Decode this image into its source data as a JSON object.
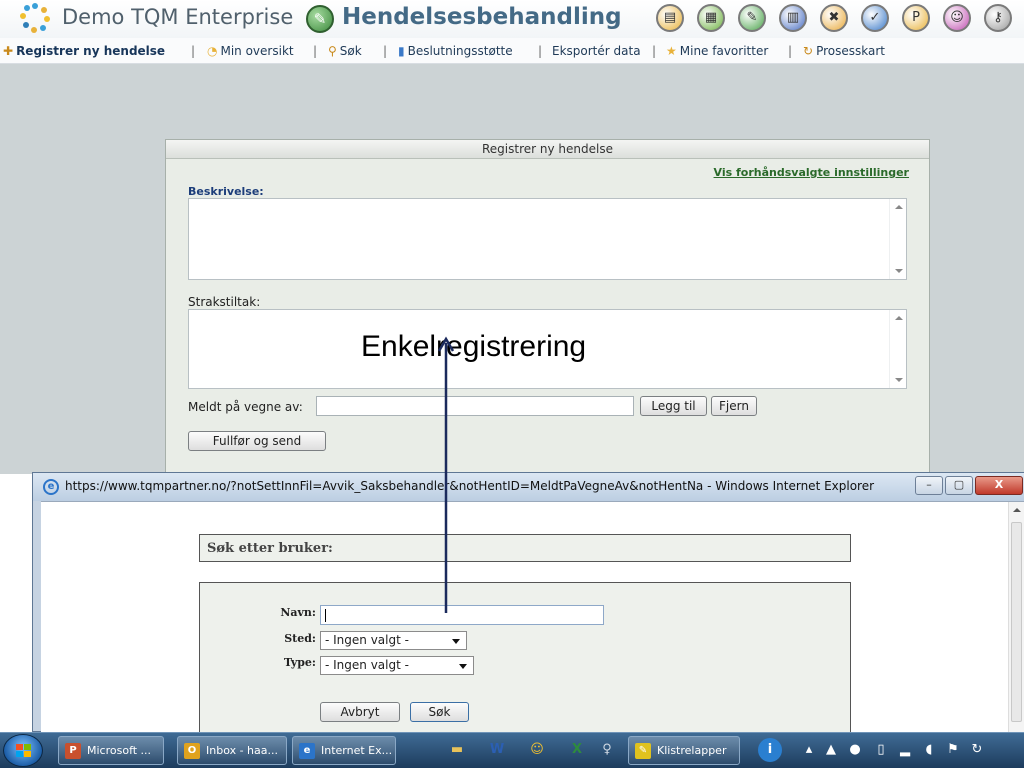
{
  "header": {
    "app_title": "Demo TQM Enterprise",
    "module_title": "Hendelsesbehandling",
    "module_icon": "wrench-icon",
    "toolbar_icons": [
      {
        "icon": "document-icon",
        "color": "#e8b23a"
      },
      {
        "icon": "dashboard-icon",
        "color": "#6cb03f"
      },
      {
        "icon": "wrench-icon",
        "color": "#4aa34a"
      },
      {
        "icon": "calendar-icon",
        "color": "#4a6fc2"
      },
      {
        "icon": "tools-icon",
        "color": "#e8a93a"
      },
      {
        "icon": "checkmark-icon",
        "color": "#3a79c8"
      },
      {
        "icon": "ps-icon",
        "color": "#e8b23a"
      },
      {
        "icon": "people-icon",
        "color": "#c04fb0"
      },
      {
        "icon": "key-icon",
        "color": "#9a9a9a"
      }
    ]
  },
  "nav": {
    "items": [
      {
        "label": "Registrer ny hendelse",
        "icon": "register-icon"
      },
      {
        "label": "Min oversikt",
        "icon": "overview-icon"
      },
      {
        "label": "Søk",
        "icon": "search-icon"
      },
      {
        "label": "Beslutningsstøtte",
        "icon": "chart-icon"
      },
      {
        "label": "Eksportér data",
        "icon": ""
      },
      {
        "label": "Mine favoritter",
        "icon": "star-icon"
      },
      {
        "label": "Prosesskart",
        "icon": "process-icon"
      }
    ],
    "separator": "|"
  },
  "form": {
    "title": "Registrer ny hendelse",
    "presets_link": "Vis forhåndsvalgte innstillinger",
    "description_label": "Beskrivelse:",
    "description_value": "",
    "immediate_action_label": "Strakstiltak:",
    "immediate_action_value": "",
    "reported_on_behalf_label": "Meldt på vegne av:",
    "reported_on_behalf_value": "",
    "add_button": "Legg til",
    "remove_button": "Fjern",
    "submit_button": "Fullfør og send"
  },
  "annotation": {
    "callout_text": "Enkelregistrering",
    "arrow_color": "#1b2a5c"
  },
  "popup": {
    "window_title": "https://www.tqmpartner.no/?notSettInnFil=Avvik_Saksbehandler&notHentID=MeldtPaVegneAv&notHentNa - Windows Internet Explorer",
    "minimize_label": "–",
    "maximize_label": "▢",
    "close_label": "X",
    "search_heading": "Søk etter bruker:",
    "name_label": "Navn:",
    "name_value": "",
    "place_label": "Sted:",
    "place_selected": "- Ingen valgt -",
    "type_label": "Type:",
    "type_selected": "- Ingen valgt -",
    "cancel_button": "Avbryt",
    "search_button": "Søk"
  },
  "taskbar": {
    "tasks": [
      {
        "label": "Microsoft ...",
        "icon": "powerpoint-icon",
        "icon_letter": "P",
        "color": "#c9502e"
      },
      {
        "label": "Inbox - haa...",
        "icon": "outlook-icon",
        "icon_letter": "O",
        "color": "#e0a21e"
      },
      {
        "label": "Internet Ex...",
        "icon": "internet-explorer-icon",
        "icon_letter": "e",
        "color": "#2b74c9"
      },
      {
        "label": "Klistrelapper",
        "icon": "sticky-notes-icon",
        "icon_letter": "✎",
        "color": "#e0c21e"
      }
    ],
    "pinned_icons": [
      {
        "icon": "folder-icon",
        "glyph": "▬",
        "color": "#e8c25a"
      },
      {
        "icon": "word-icon",
        "glyph": "W",
        "color": "#2b5fb3"
      },
      {
        "icon": "messenger-icon",
        "glyph": "☺",
        "color": "#f0c030"
      },
      {
        "icon": "excel-icon",
        "glyph": "X",
        "color": "#2e8b3e"
      },
      {
        "icon": "person-icon",
        "glyph": "♀",
        "color": "#cfd8e3"
      }
    ],
    "tray_icons": [
      "info-icon",
      "chevron-up-icon",
      "network-icon",
      "circle-icon",
      "battery-icon",
      "signal-icon",
      "volume-icon",
      "flag-icon",
      "sync-icon"
    ]
  }
}
